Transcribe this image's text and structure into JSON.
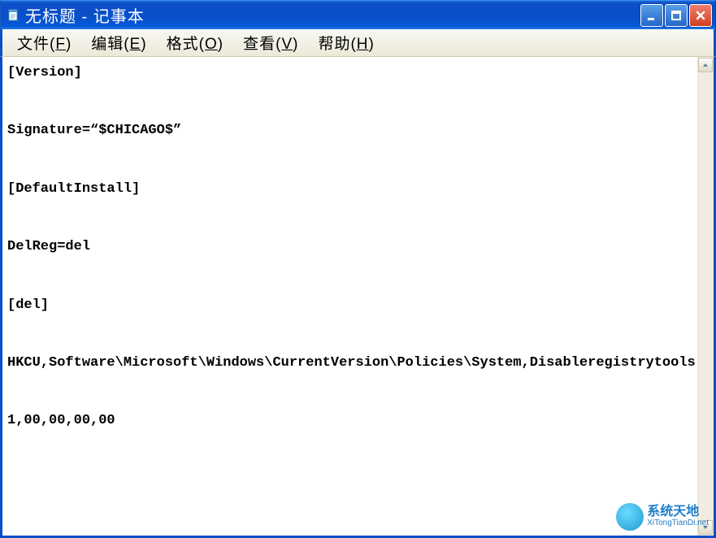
{
  "titlebar": {
    "title": "无标题 - 记事本"
  },
  "menubar": {
    "items": [
      {
        "label": "文件",
        "accel": "F"
      },
      {
        "label": "编辑",
        "accel": "E"
      },
      {
        "label": "格式",
        "accel": "O"
      },
      {
        "label": "查看",
        "accel": "V"
      },
      {
        "label": "帮助",
        "accel": "H"
      }
    ]
  },
  "editor": {
    "content": "[Version]\n\nSignature=“$CHICAGO$”\n\n[DefaultInstall]\n\nDelReg=del\n\n[del]\n\nHKCU,Software\\Microsoft\\Windows\\CurrentVersion\\Policies\\System,Disableregistrytools,\n\n1,00,00,00,00"
  },
  "watermark": {
    "name_cn": "系统天地",
    "name_en": "XiTongTianDi.net"
  }
}
